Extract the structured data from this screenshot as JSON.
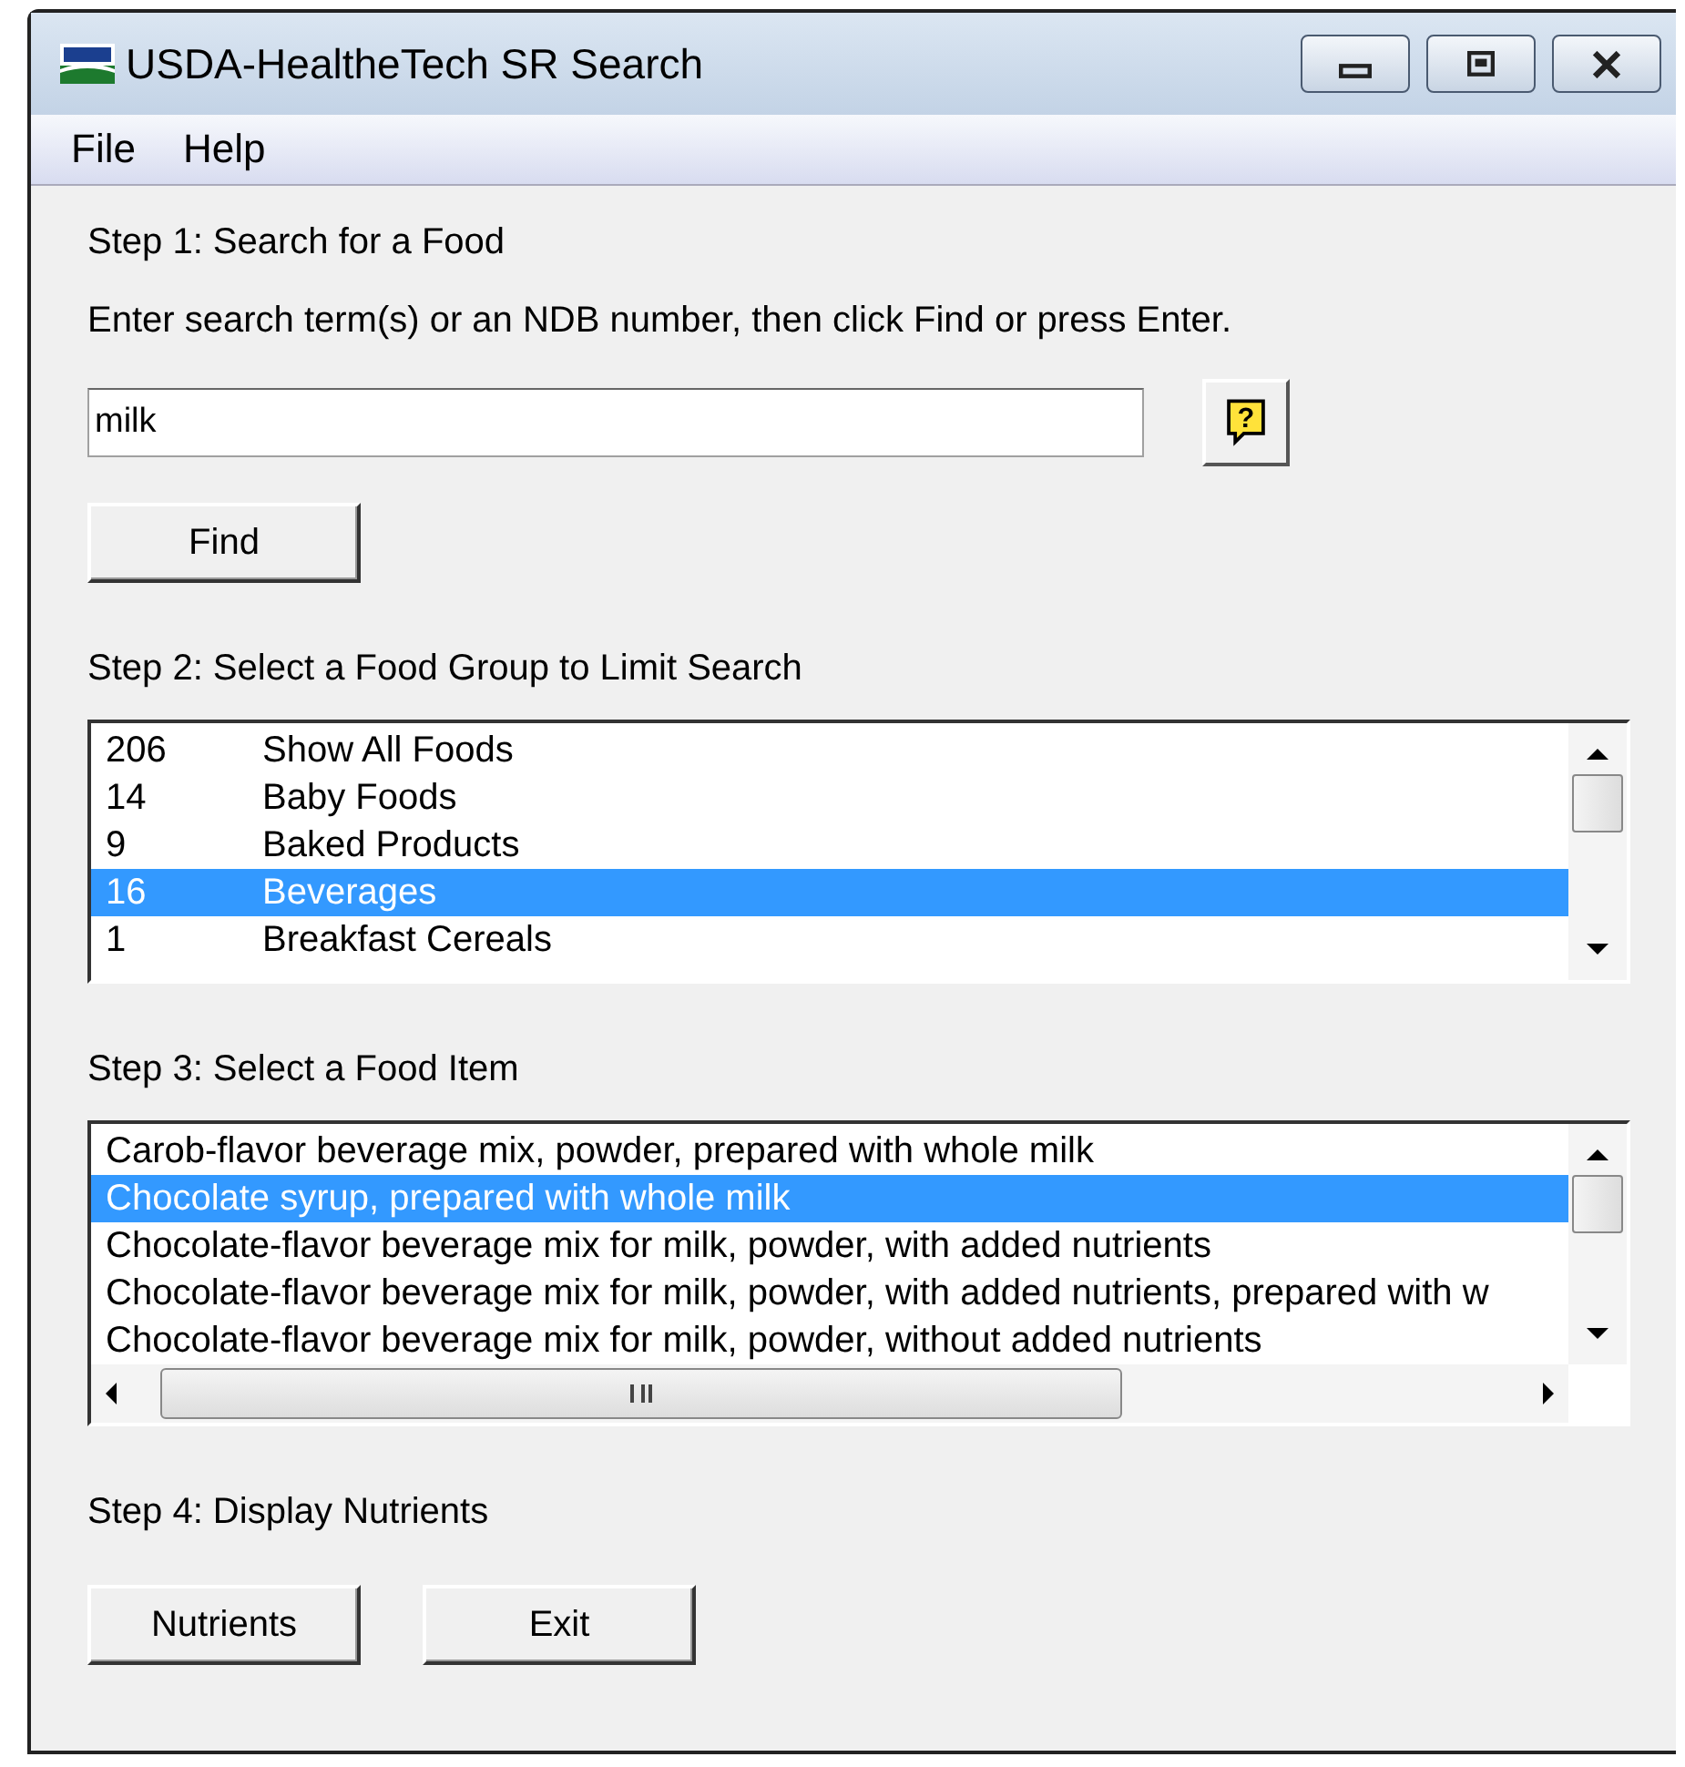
{
  "window": {
    "title": "USDA-HealtheTech SR Search"
  },
  "menu": [
    "File",
    "Help"
  ],
  "step1": {
    "heading": "Step 1: Search for a Food",
    "instructions": "Enter search term(s) or an NDB number, then click Find or press Enter.",
    "search": {
      "value": "milk"
    },
    "help_button": "?",
    "find_button": "Find"
  },
  "step2": {
    "heading": "Step 2: Select a Food Group to Limit Search",
    "groups": [
      {
        "count": "206",
        "name": "Show All Foods",
        "selected": false
      },
      {
        "count": "14",
        "name": "Baby Foods",
        "selected": false
      },
      {
        "count": "9",
        "name": "Baked Products",
        "selected": false
      },
      {
        "count": "16",
        "name": "Beverages",
        "selected": true
      },
      {
        "count": "1",
        "name": "Breakfast Cereals",
        "selected": false
      }
    ]
  },
  "step3": {
    "heading": "Step 3: Select a Food Item",
    "items": [
      {
        "label": "Carob-flavor beverage mix, powder, prepared with whole milk",
        "selected": false
      },
      {
        "label": "Chocolate syrup, prepared with whole milk",
        "selected": true
      },
      {
        "label": "Chocolate-flavor beverage mix for milk, powder, with added nutrients",
        "selected": false
      },
      {
        "label": "Chocolate-flavor beverage mix for milk, powder, with added nutrients, prepared with w",
        "selected": false
      },
      {
        "label": "Chocolate-flavor beverage mix for milk, powder, without added nutrients",
        "selected": false
      }
    ]
  },
  "step4": {
    "heading": "Step 4: Display Nutrients",
    "buttons": [
      "Nutrients",
      "Exit"
    ]
  }
}
